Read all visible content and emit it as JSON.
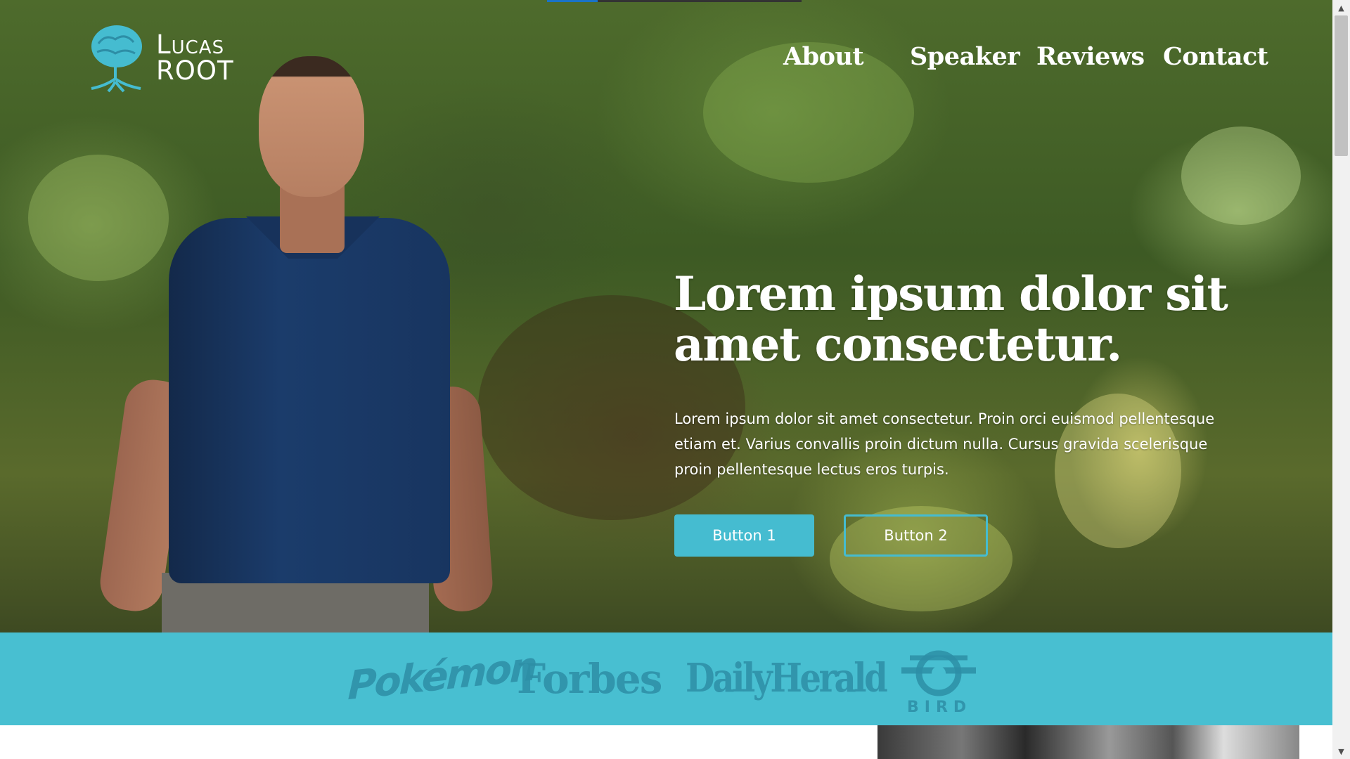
{
  "brand": {
    "line1": "Lucas",
    "line2": "Root",
    "icon": "tree-brain-icon",
    "accent": "#45bcd0"
  },
  "nav": {
    "items": [
      "About",
      "Speaker",
      "Reviews",
      "Contact"
    ]
  },
  "hero": {
    "title": "Lorem ipsum dolor sit amet consectetur.",
    "text": "Lorem ipsum dolor sit amet consectetur. Proin orci euismod pellentesque etiam et. Varius convallis proin dictum nulla. Cursus gravida scelerisque proin pellentesque lectus eros turpis.",
    "button1": "Button 1",
    "button2": "Button 2"
  },
  "press_logos": {
    "pokemon": "Pokémon",
    "forbes": "Forbes",
    "daily_herald": "DailyHerald",
    "bird": "BIRD"
  },
  "loading_bar": {
    "progress": 0.2
  },
  "colors": {
    "logo_strip": "#48bfd1",
    "logo_ink": "#2d8ea6",
    "white": "#ffffff"
  }
}
